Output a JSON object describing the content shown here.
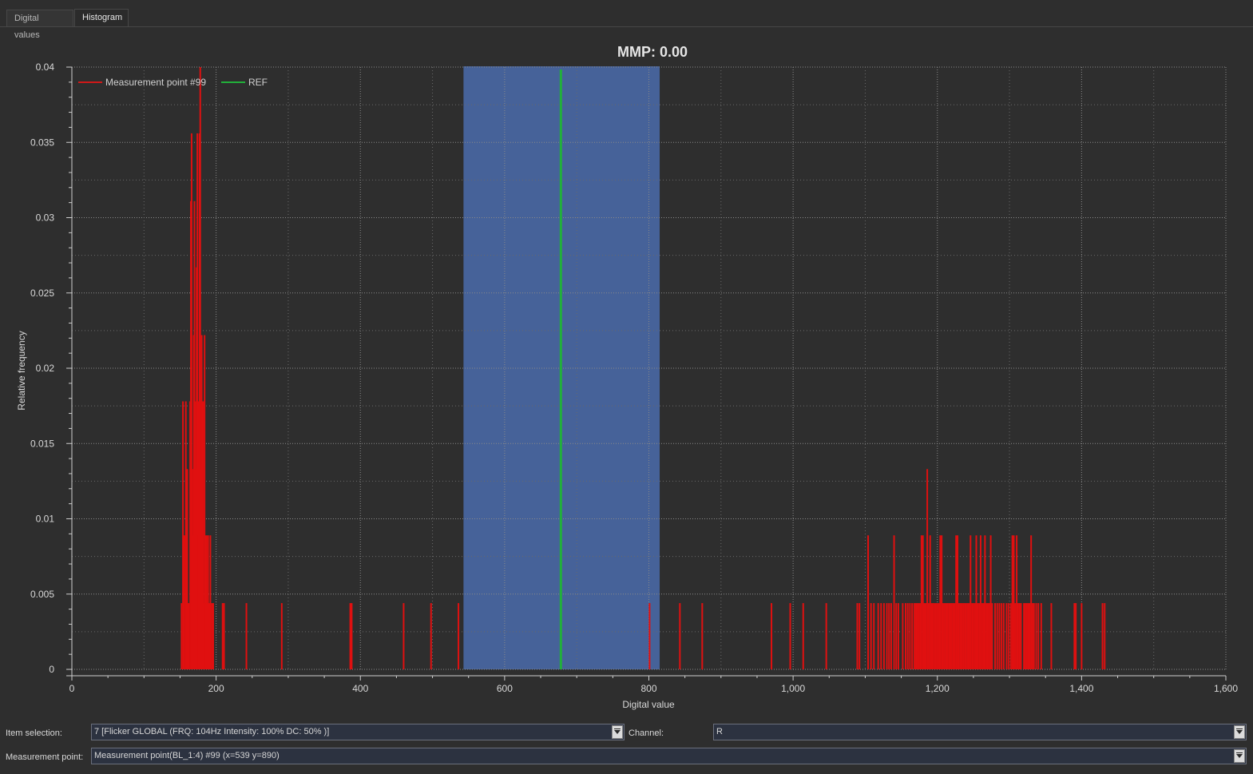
{
  "tabs": [
    {
      "label": "Digital values"
    },
    {
      "label": "Histogram"
    }
  ],
  "chart_data": {
    "type": "bar",
    "title": "MMP: 0.00",
    "xlabel": "Digital value",
    "ylabel": "Relative frequency",
    "xlim": [
      0,
      1600
    ],
    "ylim": [
      0,
      0.04
    ],
    "x_ticks": [
      "0",
      "200",
      "400",
      "600",
      "800",
      "1,000",
      "1,200",
      "1,400",
      "1,600"
    ],
    "y_ticks": [
      "0",
      "0.005",
      "0.01",
      "0.015",
      "0.02",
      "0.025",
      "0.03",
      "0.035",
      "0.04"
    ],
    "grid": true,
    "legend_position": "top-left",
    "highlight_range": [
      543,
      815
    ],
    "ref_value": 678,
    "series": [
      {
        "name": "Measurement point #99",
        "color": "#e01010",
        "points": [
          [
            152,
            0.0044
          ],
          [
            154,
            0.0178
          ],
          [
            156,
            0.0089
          ],
          [
            158,
            0.0178
          ],
          [
            160,
            0.0133
          ],
          [
            162,
            0.0044
          ],
          [
            164,
            0.0178
          ],
          [
            165,
            0.0311
          ],
          [
            166,
            0.0356
          ],
          [
            167,
            0.0133
          ],
          [
            168,
            0.0089
          ],
          [
            169,
            0.0222
          ],
          [
            170,
            0.0311
          ],
          [
            171,
            0.0178
          ],
          [
            172,
            0.0133
          ],
          [
            173,
            0.0267
          ],
          [
            174,
            0.0356
          ],
          [
            175,
            0.0089
          ],
          [
            176,
            0.0178
          ],
          [
            177,
            0.0356
          ],
          [
            178,
            0.04
          ],
          [
            179,
            0.0133
          ],
          [
            180,
            0.0222
          ],
          [
            181,
            0.0089
          ],
          [
            182,
            0.0178
          ],
          [
            183,
            0.0044
          ],
          [
            184,
            0.0222
          ],
          [
            185,
            0.0089
          ],
          [
            186,
            0.0044
          ],
          [
            187,
            0.0089
          ],
          [
            188,
            0.0044
          ],
          [
            189,
            0.0089
          ],
          [
            190,
            0.0044
          ],
          [
            192,
            0.0089
          ],
          [
            194,
            0.0044
          ],
          [
            196,
            0.0044
          ],
          [
            209,
            0.0044
          ],
          [
            211,
            0.0044
          ],
          [
            242,
            0.0044
          ],
          [
            291,
            0.0044
          ],
          [
            386,
            0.0044
          ],
          [
            388,
            0.0044
          ],
          [
            460,
            0.0044
          ],
          [
            498,
            0.0044
          ],
          [
            536,
            0.0044
          ],
          [
            801,
            0.0044
          ],
          [
            843,
            0.0044
          ],
          [
            874,
            0.0044
          ],
          [
            970,
            0.0044
          ],
          [
            996,
            0.0044
          ],
          [
            1014,
            0.0044
          ],
          [
            1046,
            0.0044
          ],
          [
            1089,
            0.0044
          ],
          [
            1092,
            0.0044
          ],
          [
            1104,
            0.0089
          ],
          [
            1108,
            0.0044
          ],
          [
            1112,
            0.0044
          ],
          [
            1118,
            0.0044
          ],
          [
            1122,
            0.0044
          ],
          [
            1126,
            0.0044
          ],
          [
            1130,
            0.0044
          ],
          [
            1133,
            0.0044
          ],
          [
            1136,
            0.0044
          ],
          [
            1140,
            0.0089
          ],
          [
            1143,
            0.0044
          ],
          [
            1146,
            0.0044
          ],
          [
            1152,
            0.0044
          ],
          [
            1156,
            0.0044
          ],
          [
            1159,
            0.0044
          ],
          [
            1162,
            0.0044
          ],
          [
            1165,
            0.0044
          ],
          [
            1168,
            0.0044
          ],
          [
            1170,
            0.0044
          ],
          [
            1172,
            0.0044
          ],
          [
            1174,
            0.0044
          ],
          [
            1176,
            0.0044
          ],
          [
            1178,
            0.0089
          ],
          [
            1180,
            0.0089
          ],
          [
            1182,
            0.0044
          ],
          [
            1184,
            0.0044
          ],
          [
            1186,
            0.0133
          ],
          [
            1188,
            0.0044
          ],
          [
            1190,
            0.0089
          ],
          [
            1192,
            0.0044
          ],
          [
            1194,
            0.0044
          ],
          [
            1196,
            0.0044
          ],
          [
            1198,
            0.0044
          ],
          [
            1200,
            0.0044
          ],
          [
            1202,
            0.0044
          ],
          [
            1204,
            0.0089
          ],
          [
            1206,
            0.0089
          ],
          [
            1208,
            0.0044
          ],
          [
            1210,
            0.0044
          ],
          [
            1212,
            0.0044
          ],
          [
            1214,
            0.0044
          ],
          [
            1216,
            0.0044
          ],
          [
            1218,
            0.0044
          ],
          [
            1220,
            0.0044
          ],
          [
            1222,
            0.0044
          ],
          [
            1224,
            0.0044
          ],
          [
            1226,
            0.0089
          ],
          [
            1228,
            0.0089
          ],
          [
            1230,
            0.0044
          ],
          [
            1232,
            0.0044
          ],
          [
            1234,
            0.0044
          ],
          [
            1236,
            0.0044
          ],
          [
            1238,
            0.0044
          ],
          [
            1240,
            0.0044
          ],
          [
            1242,
            0.0044
          ],
          [
            1244,
            0.0044
          ],
          [
            1246,
            0.0089
          ],
          [
            1248,
            0.0044
          ],
          [
            1250,
            0.0044
          ],
          [
            1252,
            0.0044
          ],
          [
            1254,
            0.0089
          ],
          [
            1256,
            0.0044
          ],
          [
            1258,
            0.0044
          ],
          [
            1260,
            0.0089
          ],
          [
            1262,
            0.0044
          ],
          [
            1264,
            0.0044
          ],
          [
            1266,
            0.0089
          ],
          [
            1268,
            0.0044
          ],
          [
            1270,
            0.0044
          ],
          [
            1272,
            0.0044
          ],
          [
            1274,
            0.0089
          ],
          [
            1276,
            0.0044
          ],
          [
            1280,
            0.0044
          ],
          [
            1283,
            0.0044
          ],
          [
            1286,
            0.0044
          ],
          [
            1289,
            0.0044
          ],
          [
            1292,
            0.0044
          ],
          [
            1296,
            0.0044
          ],
          [
            1299,
            0.0044
          ],
          [
            1302,
            0.0044
          ],
          [
            1304,
            0.0089
          ],
          [
            1306,
            0.0089
          ],
          [
            1308,
            0.0044
          ],
          [
            1310,
            0.0089
          ],
          [
            1312,
            0.0044
          ],
          [
            1314,
            0.0044
          ],
          [
            1316,
            0.0044
          ],
          [
            1320,
            0.0044
          ],
          [
            1322,
            0.0044
          ],
          [
            1324,
            0.0044
          ],
          [
            1326,
            0.0044
          ],
          [
            1328,
            0.0044
          ],
          [
            1330,
            0.0089
          ],
          [
            1332,
            0.0044
          ],
          [
            1334,
            0.0044
          ],
          [
            1337,
            0.0044
          ],
          [
            1340,
            0.0044
          ],
          [
            1344,
            0.0044
          ],
          [
            1358,
            0.0044
          ],
          [
            1390,
            0.0044
          ],
          [
            1392,
            0.0044
          ],
          [
            1400,
            0.0044
          ],
          [
            1429,
            0.0044
          ],
          [
            1432,
            0.0044
          ]
        ]
      },
      {
        "name": "REF",
        "color": "#22b03a"
      }
    ]
  },
  "form": {
    "item_selection_label": "Item selection:",
    "item_selection_value": "7 [Flicker GLOBAL (FRQ: 104Hz  Intensity: 100% DC: 50% )]",
    "channel_label": "Channel:",
    "channel_value": "R",
    "measurement_point_label": "Measurement point:",
    "measurement_point_value": "Measurement point(BL_1:4) #99 (x=539 y=890)"
  },
  "colors": {
    "background": "#2e2e2e",
    "highlight": "#4a6aa8",
    "grid": "#8a8a8a"
  }
}
